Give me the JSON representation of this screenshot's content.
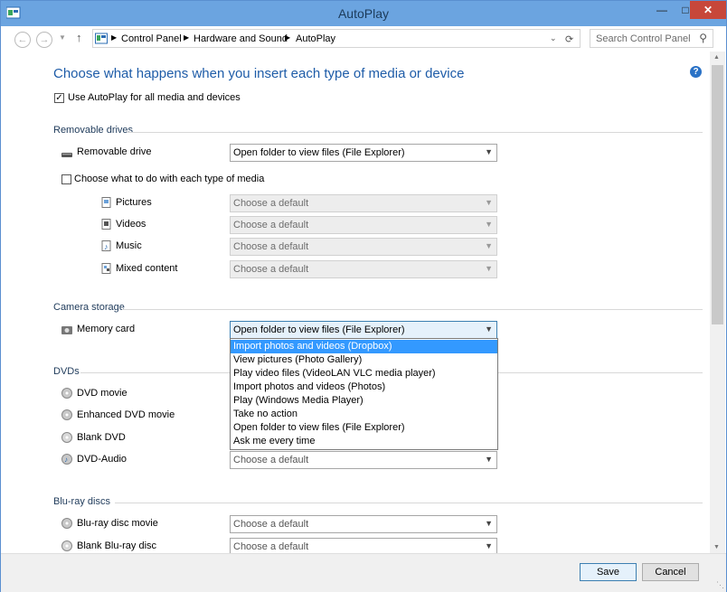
{
  "window": {
    "title": "AutoPlay"
  },
  "nav": {
    "breadcrumb": [
      "Control Panel",
      "Hardware and Sound",
      "AutoPlay"
    ],
    "search_placeholder": "Search Control Panel"
  },
  "main": {
    "heading": "Choose what happens when you insert each type of media or device",
    "use_autoplay_label": "Use AutoPlay for all media and devices",
    "removable": {
      "section_title": "Removable drives",
      "drive_label": "Removable drive",
      "drive_value": "Open folder to view files (File Explorer)",
      "choose_label": "Choose what to do with each type of media",
      "media": [
        {
          "label": "Pictures",
          "value": "Choose a default"
        },
        {
          "label": "Videos",
          "value": "Choose a default"
        },
        {
          "label": "Music",
          "value": "Choose a default"
        },
        {
          "label": "Mixed content",
          "value": "Choose a default"
        }
      ]
    },
    "camera": {
      "section_title": "Camera storage",
      "memory_label": "Memory card",
      "memory_value": "Open folder to view files (File Explorer)",
      "options": [
        "Import photos and videos (Dropbox)",
        "View pictures (Photo Gallery)",
        "Play video files (VideoLAN VLC media player)",
        "Import photos and videos (Photos)",
        "Play (Windows Media Player)",
        "Take no action",
        "Open folder to view files (File Explorer)",
        "Ask me every time"
      ]
    },
    "dvds": {
      "section_title": "DVDs",
      "items": [
        "DVD movie",
        "Enhanced DVD movie",
        "Blank DVD",
        "DVD-Audio"
      ],
      "dvd_audio_value": "Choose a default"
    },
    "bluray": {
      "section_title": "Blu-ray discs",
      "items": [
        {
          "label": "Blu-ray disc movie",
          "value": "Choose a default"
        },
        {
          "label": "Blank Blu-ray disc",
          "value": "Choose a default"
        }
      ]
    }
  },
  "footer": {
    "save_label": "Save",
    "cancel_label": "Cancel"
  },
  "colors": {
    "accent": "#1e5ca8",
    "titlebar": "#6ba4e0",
    "close": "#c7473a",
    "selection": "#3399ff"
  }
}
